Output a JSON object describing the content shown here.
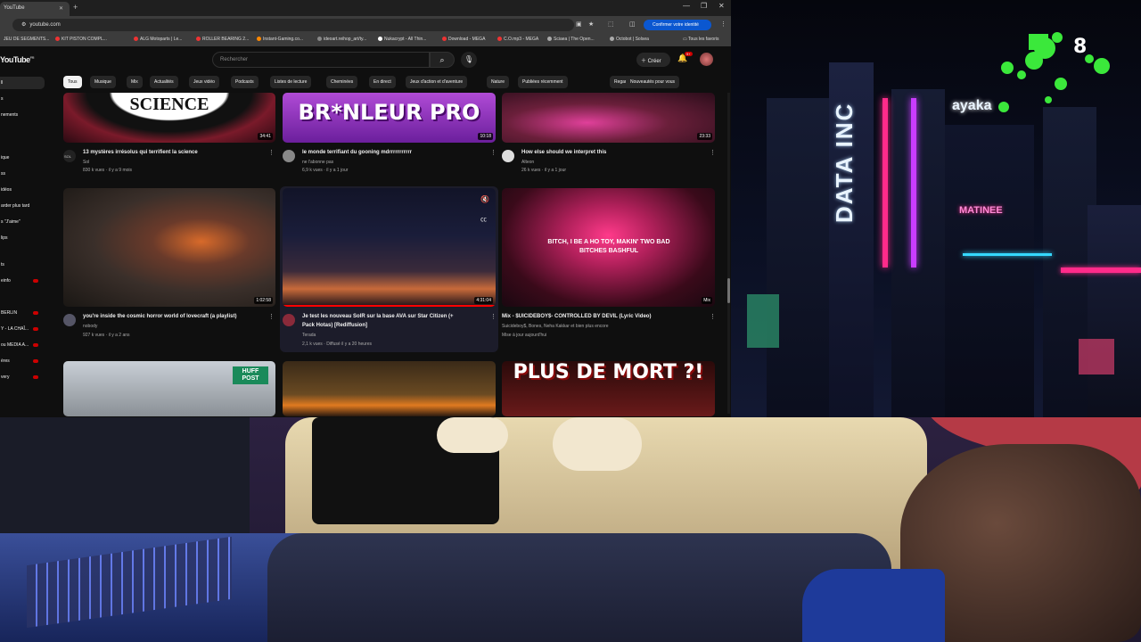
{
  "browser": {
    "tab_title": "YouTube",
    "url": "youtube.com",
    "profile_label": "Confirmer votre identité",
    "bookmarks": [
      "JEU DE SEGMENTS...",
      "KIT PISTON COMPL...",
      "ALG Motoparts | Le...",
      "ROLLER BEARING 2...",
      "Instant-Gaming.co...",
      "ideoart.reihop_art/ty...",
      "Nukacrypt - All Thin...",
      "Download - MEGA",
      "C.O.mp3 - MEGA",
      "Sciaea | The Open...",
      "Octobot | Solsea"
    ],
    "all_favorites": "Tous les favoris"
  },
  "youtube": {
    "logo": "YouTube",
    "logo_region": "FR",
    "search_placeholder": "Rechercher",
    "create_label": "Créer",
    "notif_count": "9+",
    "sidebar": [
      "ll",
      "s",
      "nements",
      "ique",
      "ss",
      "idéos",
      "arder plus tard",
      "s \"J'aime\"",
      "lips",
      "ts",
      "einfo",
      "BERLIN",
      "Y - LA CHAÎ...",
      "ou MEDIA A...",
      "ères",
      "very"
    ],
    "chips": [
      "Tous",
      "Musique",
      "Mix",
      "Actualités",
      "Jeux vidéo",
      "Podcasts",
      "Listes de lecture",
      "Cheminées",
      "En direct",
      "Jeux d'action et d'aventure",
      "Nature",
      "Publiées récemment",
      "Regardées",
      "Nouveautés pour vous"
    ],
    "videos": [
      {
        "thumb_text": "SCIENCE",
        "duration": "34:41",
        "title": "13 mystères irrésolus qui terrifient la science",
        "channel": "Sol",
        "meta": "830 k vues · il y a 9 mois"
      },
      {
        "thumb_text": "BR*NLEUR PRO",
        "duration": "10:18",
        "title": "le monde terrifiant du gooning mdrrrrrrrrrrr",
        "channel": "ne l'abonne pas",
        "meta": "6,9 k vues · il y a 1 jour"
      },
      {
        "thumb_text": "",
        "duration": "23:33",
        "title": "How else should we interpret this",
        "channel": "Alteon",
        "meta": "26 k vues · il y a 1 jour"
      },
      {
        "thumb_text": "",
        "duration": "1:02:58",
        "title": "you're inside the cosmic horror world of lovecraft (a playlist)",
        "channel": "nobody",
        "meta": "927 k vues · il y a 2 ans"
      },
      {
        "thumb_text": "",
        "duration": "4:31:04",
        "title": "Je test les nouveau SolR sur la base AVA sur Star Citizen (+",
        "title2": "Pack Hotas) [Rediffusion]",
        "channel": "Terada",
        "meta": "2,1 k vues · Diffusé il y a 20 heures"
      },
      {
        "thumb_text": "BITCH, I BE A HO TOY, MAKIN' TWO BAD BITCHES BASHFUL",
        "duration": "Mix",
        "title": "Mix - $UICIDEBOY$- CONTROLLED BY DEVIL (Lyric Video)",
        "channel": "Suicideboy$, Bones, Neha Kakkar et bien plus encore",
        "meta": "Mise à jour aujourd'hui"
      },
      {
        "thumb_text": "HUFF POST",
        "duration": "",
        "title": "",
        "channel": "",
        "meta": ""
      },
      {
        "thumb_text": "",
        "duration": "",
        "title": "",
        "channel": "",
        "meta": ""
      },
      {
        "thumb_text": "PLUS DE MORT ?!",
        "duration": "",
        "title": "",
        "channel": "",
        "meta": ""
      }
    ]
  },
  "overlay": {
    "counter": "8",
    "signs": [
      "DATA INC",
      "ayaka",
      "MATINEE"
    ]
  },
  "colors": {
    "yt_bg": "#0f0f0f",
    "chip_bg": "#272727",
    "accent_red": "#ff0000",
    "neon_green": "#3be83b",
    "neon_pink": "#ff2b8a",
    "neon_cyan": "#35d8ff"
  }
}
